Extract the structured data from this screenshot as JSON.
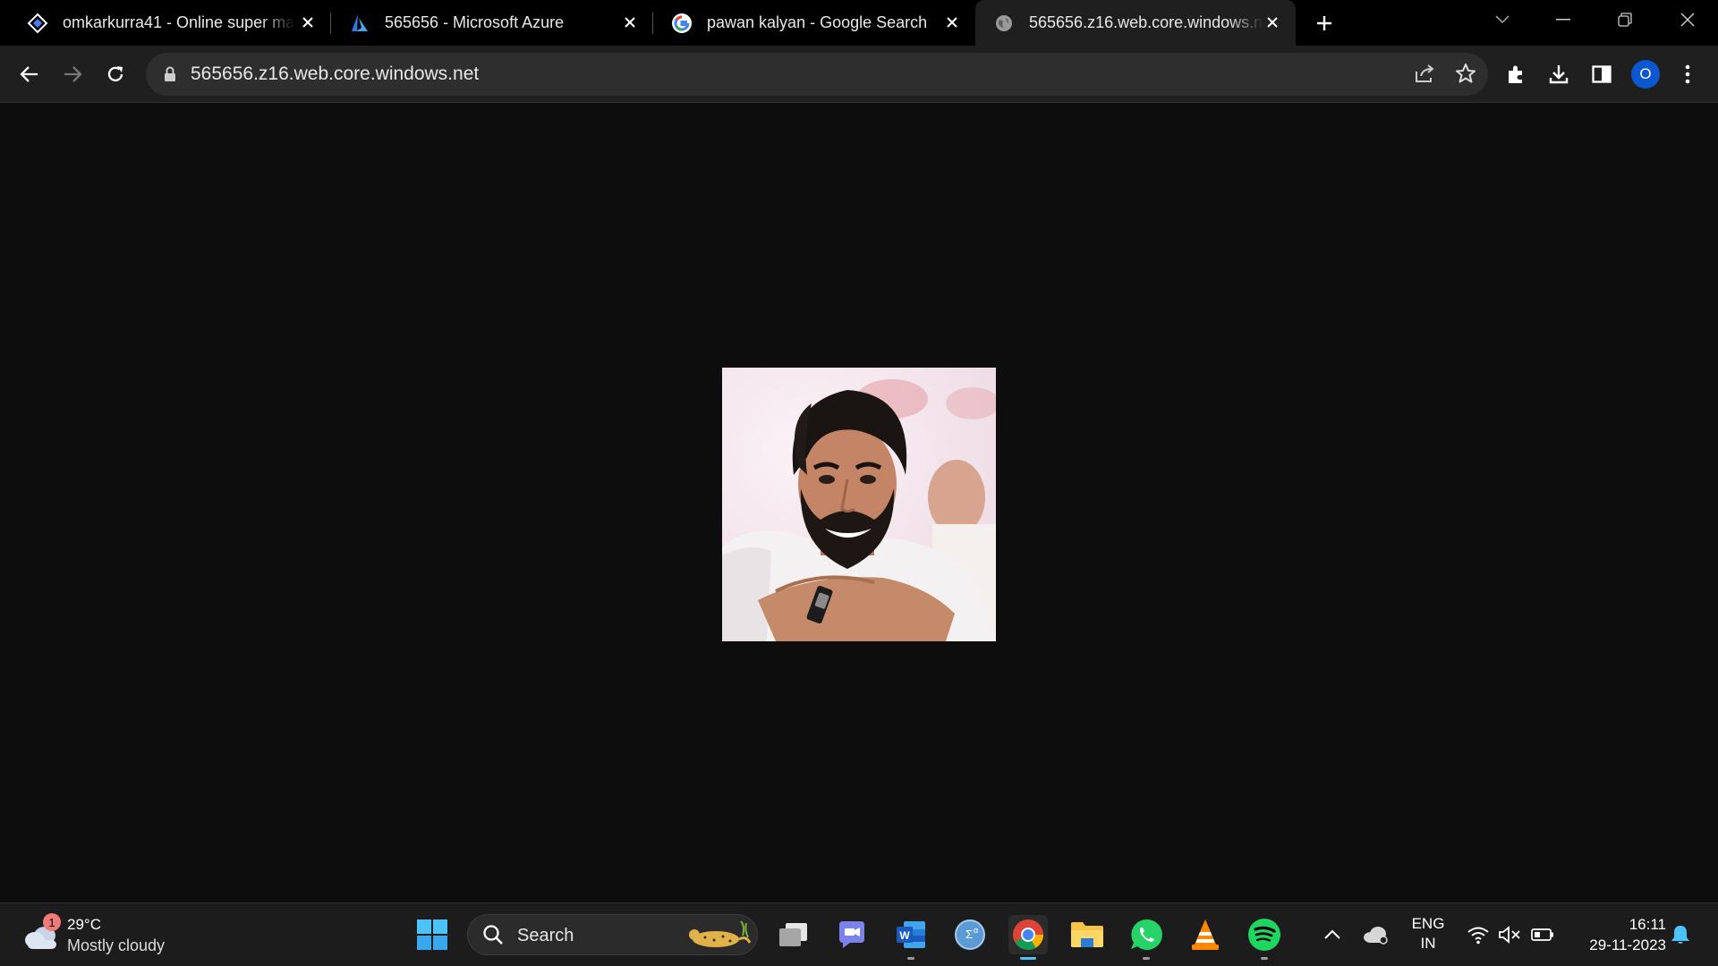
{
  "tabs": [
    {
      "title": "omkarkurra41 - Online super ma",
      "favicon": "rocket-diamond-icon",
      "active": false
    },
    {
      "title": "565656 - Microsoft Azure",
      "favicon": "azure-icon",
      "active": false
    },
    {
      "title": "pawan kalyan - Google Search",
      "favicon": "google-icon",
      "active": false
    },
    {
      "title": "565656.z16.web.core.windows.ne",
      "favicon": "globe-icon",
      "active": true
    }
  ],
  "address_bar": {
    "url": "565656.z16.web.core.windows.net"
  },
  "profile": {
    "initial": "O",
    "color": "#0b57d0"
  },
  "page": {
    "image_alt": "photo of a smiling bearded man"
  },
  "taskbar": {
    "weather": {
      "badge": "1",
      "temp": "29°C",
      "condition": "Mostly cloudy"
    },
    "search_label": "Search",
    "pinned": [
      "start-icon",
      "task-view-icon",
      "teams-icon",
      "word-icon",
      "calculator-icon",
      "chrome-icon",
      "file-explorer-icon",
      "whatsapp-icon",
      "vlc-icon",
      "spotify-icon"
    ]
  },
  "tray": {
    "language_line1": "ENG",
    "language_line2": "IN",
    "time": "16:11",
    "date": "29-11-2023"
  },
  "colors": {
    "accent": "#4cc2ff",
    "tab_active": "#1f1f1f",
    "background": "#0d0d0d"
  }
}
